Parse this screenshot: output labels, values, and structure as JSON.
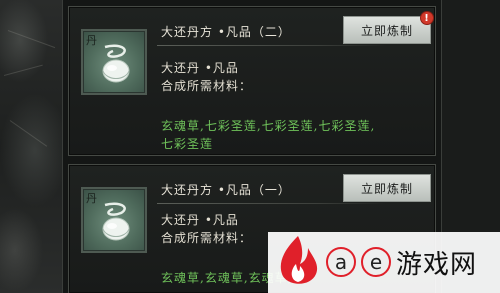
{
  "recipes": [
    {
      "icon_label": "丹",
      "title": "大还丹方 •凡品（二）",
      "button_label": "立即炼制",
      "badge": "!",
      "item_name": "大还丹 •凡品",
      "materials_label": "合成所需材料：",
      "materials_line1": "玄魂草,七彩圣莲,七彩圣莲,七彩圣莲,",
      "materials_line2": "七彩圣莲"
    },
    {
      "icon_label": "丹",
      "title": "大还丹方 •凡品（一）",
      "button_label": "立即炼制",
      "item_name": "大还丹 •凡品",
      "materials_label": "合成所需材料：",
      "materials_line1": "玄魂草,玄魂草,玄魂草,"
    }
  ],
  "watermark": {
    "letter_a": "a",
    "letter_e": "e",
    "text": "游戏网"
  },
  "colors": {
    "materials": "#6fc25a",
    "badge": "#d1392a",
    "button": "#d3d8d3"
  }
}
